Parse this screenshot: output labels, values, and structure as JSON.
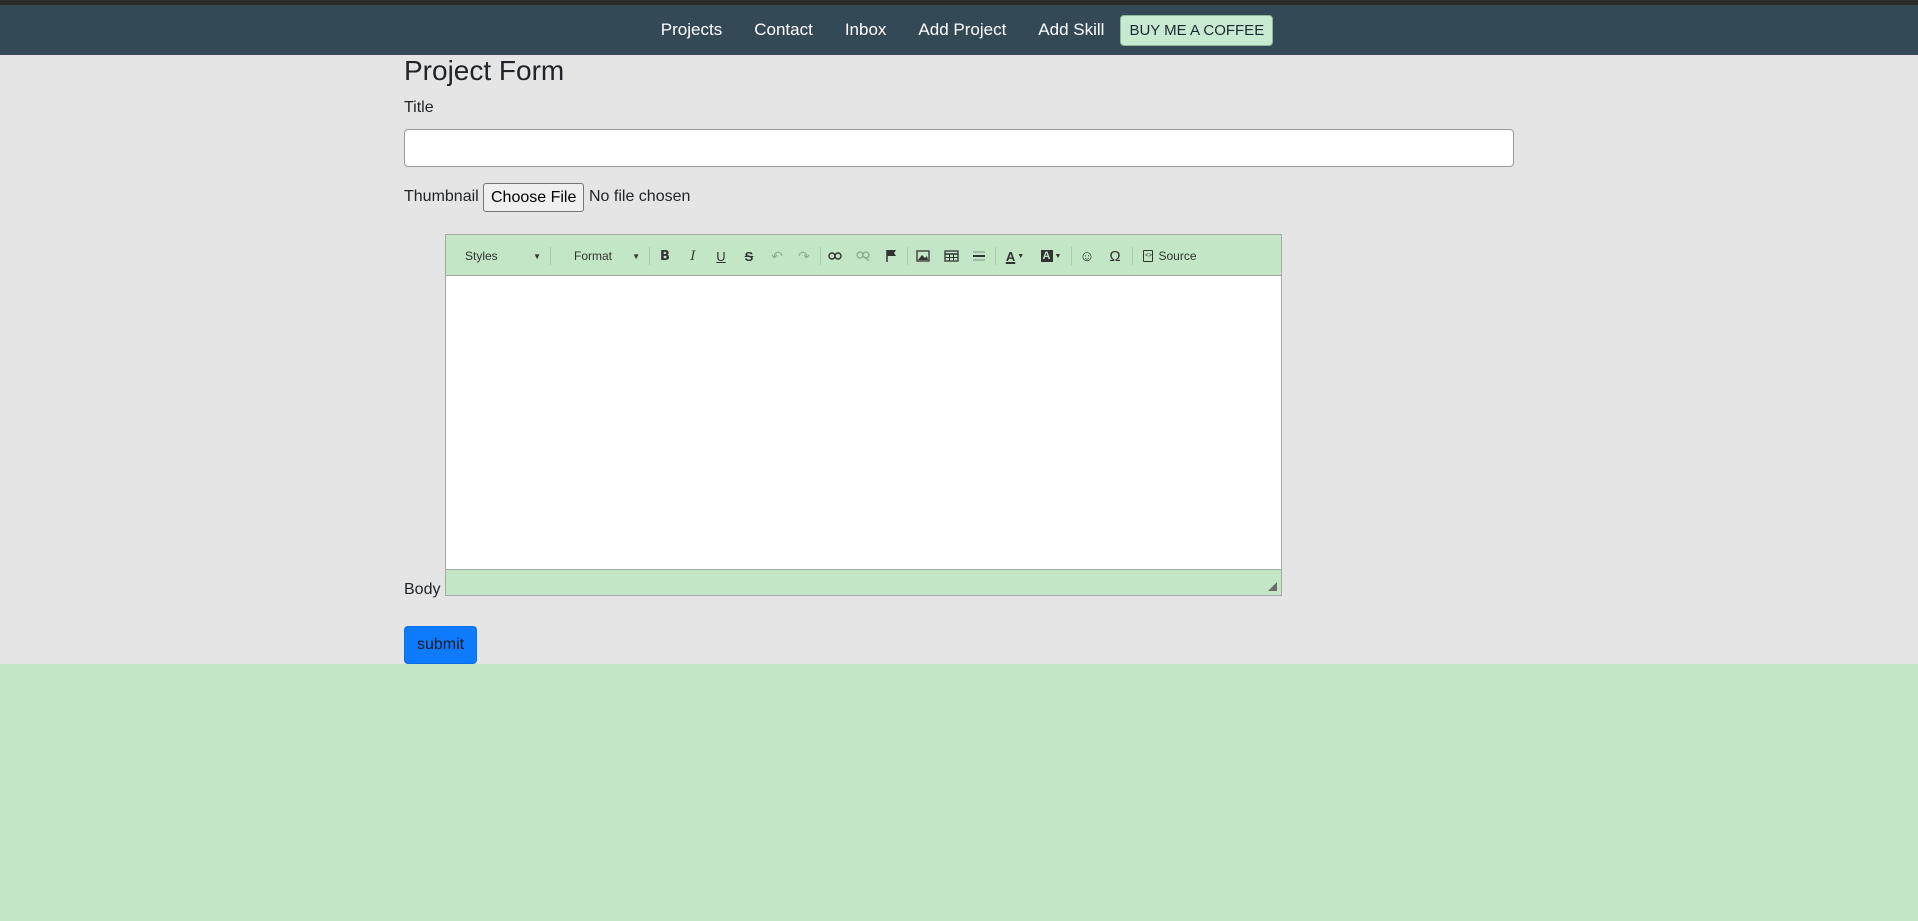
{
  "nav": {
    "links": [
      "Projects",
      "Contact",
      "Inbox",
      "Add Project",
      "Add Skill"
    ],
    "coffee_label": "BUY ME A COFFEE"
  },
  "form": {
    "heading": "Project Form",
    "title_label": "Title",
    "title_value": "",
    "thumbnail_label": "Thumbnail",
    "file_button": "Choose File",
    "file_status": "No file chosen",
    "body_label": "Body",
    "submit_label": "submit"
  },
  "editor": {
    "styles_label": "Styles",
    "format_label": "Format",
    "source_label": "Source",
    "icons": [
      "bold-icon",
      "italic-icon",
      "underline-icon",
      "strikethrough-icon",
      "undo-icon",
      "redo-icon",
      "link-icon",
      "unlink-icon",
      "anchor-icon",
      "image-icon",
      "table-icon",
      "horizontal-line-icon",
      "text-color-icon",
      "background-color-icon",
      "smiley-icon",
      "special-char-icon",
      "source-icon"
    ]
  },
  "colors": {
    "navbar": "#344956",
    "toolbar": "#c2e6c6",
    "page_background": "#e5e5e5",
    "submit": "#0d7bfb"
  }
}
